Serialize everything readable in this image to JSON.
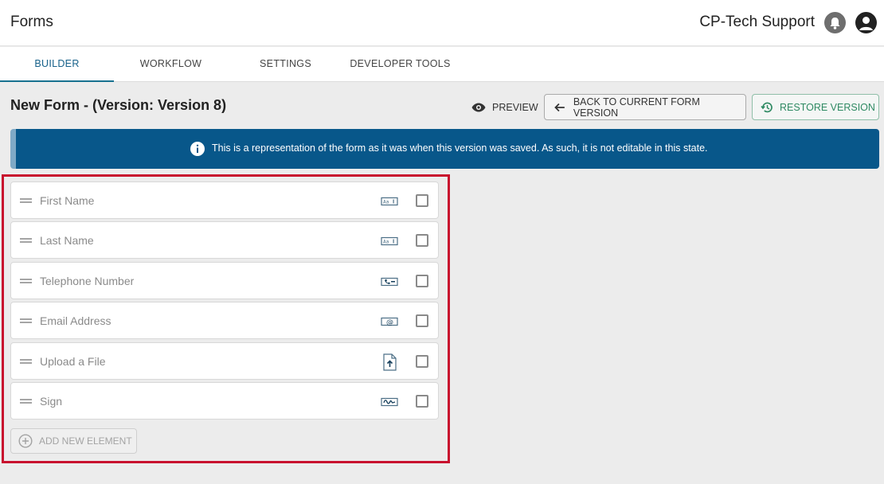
{
  "app": {
    "title": "Forms",
    "user_name": "CP-Tech Support"
  },
  "tabs": [
    {
      "label": "BUILDER",
      "active": true
    },
    {
      "label": "WORKFLOW",
      "active": false
    },
    {
      "label": "SETTINGS",
      "active": false
    },
    {
      "label": "DEVELOPER TOOLS",
      "active": false
    }
  ],
  "form": {
    "title": "New Form - (Version: Version 8)",
    "preview_label": "PREVIEW",
    "back_label": "BACK TO CURRENT FORM VERSION",
    "restore_label": "RESTORE VERSION"
  },
  "banner": {
    "text": "This is a representation of the form as it was when this version was saved. As such, it is not editable in this state."
  },
  "elements": [
    {
      "label": "First Name",
      "icon": "text-field-icon"
    },
    {
      "label": "Last Name",
      "icon": "text-field-icon"
    },
    {
      "label": "Telephone Number",
      "icon": "phone-field-icon"
    },
    {
      "label": "Email Address",
      "icon": "email-field-icon"
    },
    {
      "label": "Upload a File",
      "icon": "file-upload-icon"
    },
    {
      "label": "Sign",
      "icon": "signature-icon"
    }
  ],
  "add_element_label": "ADD NEW ELEMENT",
  "colors": {
    "accent": "#17618a",
    "banner": "#08578a",
    "restore": "#2f8a63",
    "highlight": "#c8102e"
  }
}
